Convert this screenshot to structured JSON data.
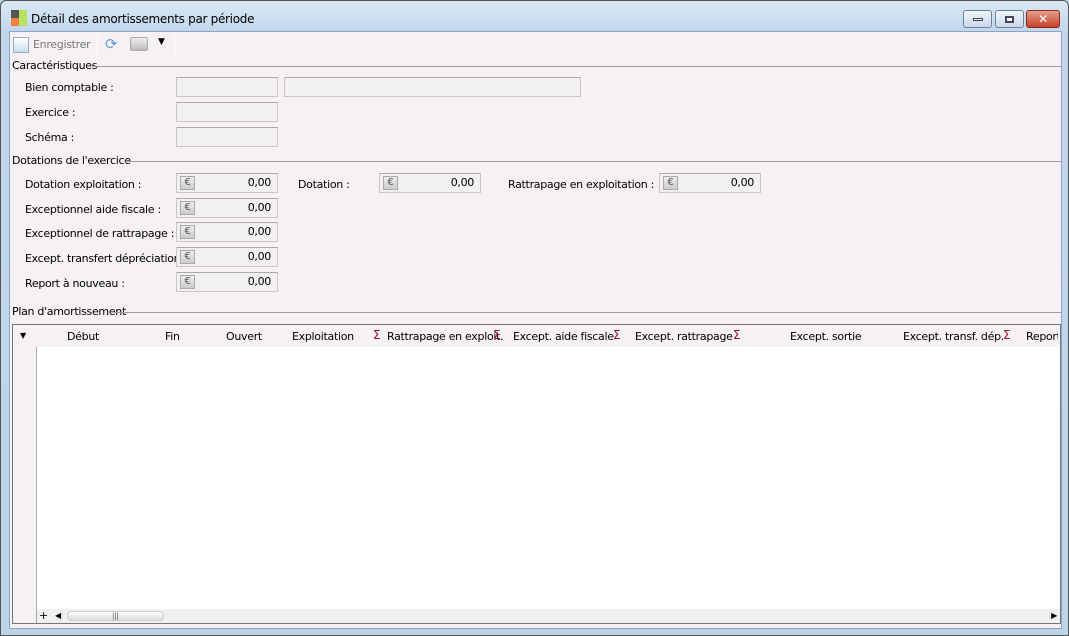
{
  "window": {
    "title": "Détail des amortissements par période"
  },
  "toolbar": {
    "save_label": "Enregistrer"
  },
  "caracteristiques": {
    "section_title": "Caractéristiques",
    "bien_label": "Bien comptable :",
    "bien_code": "",
    "bien_name": "",
    "exercice_label": "Exercice :",
    "exercice_value": "",
    "schema_label": "Schéma :",
    "schema_value": ""
  },
  "dotations": {
    "section_title": "Dotations de l'exercice",
    "currency_symbol": "€",
    "dotation_exploitation": {
      "label": "Dotation exploitation :",
      "value": "0,00"
    },
    "dotation": {
      "label": "Dotation :",
      "value": "0,00"
    },
    "rattrapage_exploitation": {
      "label": "Rattrapage en exploitation :",
      "value": "0,00"
    },
    "exceptionnel_aide_fiscale": {
      "label": "Exceptionnel aide fiscale :",
      "value": "0,00"
    },
    "exceptionnel_rattrapage": {
      "label": "Exceptionnel de rattrapage :",
      "value": "0,00"
    },
    "except_transfert": {
      "label": "Except. transfert dépréciation :",
      "value": "0,00"
    },
    "report": {
      "label": "Report à nouveau :",
      "value": "0,00"
    }
  },
  "plan": {
    "section_title": "Plan d'amortissement",
    "sigma": "Σ",
    "columns": [
      "Début",
      "Fin",
      "Ouvert",
      "Exploitation",
      "Rattrapage en exploit.",
      "Except. aide fiscale",
      "Except. rattrapage",
      "Except. sortie",
      "Except. transf. dép.",
      "Report"
    ],
    "add_label": "+"
  }
}
